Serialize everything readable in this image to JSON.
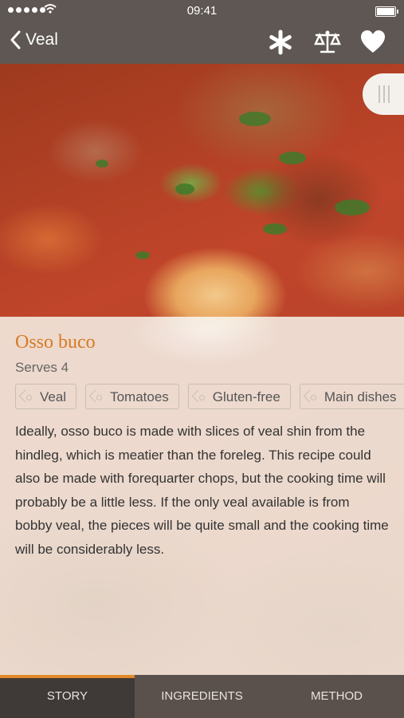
{
  "status_bar": {
    "time": "09:41"
  },
  "nav": {
    "back_label": "Veal"
  },
  "recipe": {
    "title": "Osso buco",
    "serves": "Serves 4",
    "tags": [
      "Veal",
      "Tomatoes",
      "Gluten-free",
      "Main dishes"
    ],
    "description": "Ideally, osso buco is made with slices of veal shin from the hindleg, which is meatier than the foreleg. This recipe could also be made with forequarter chops, but the cooking time will probably be a little less. If the only veal available is from bobby veal, the pieces will be quite small and the cooking time will be considerably less."
  },
  "tabs": [
    {
      "label": "STORY",
      "active": true
    },
    {
      "label": "INGREDIENTS",
      "active": false
    },
    {
      "label": "METHOD",
      "active": false
    }
  ],
  "colors": {
    "accent": "#e08a2a",
    "title": "#d77a24",
    "bar": "#5f5753"
  }
}
